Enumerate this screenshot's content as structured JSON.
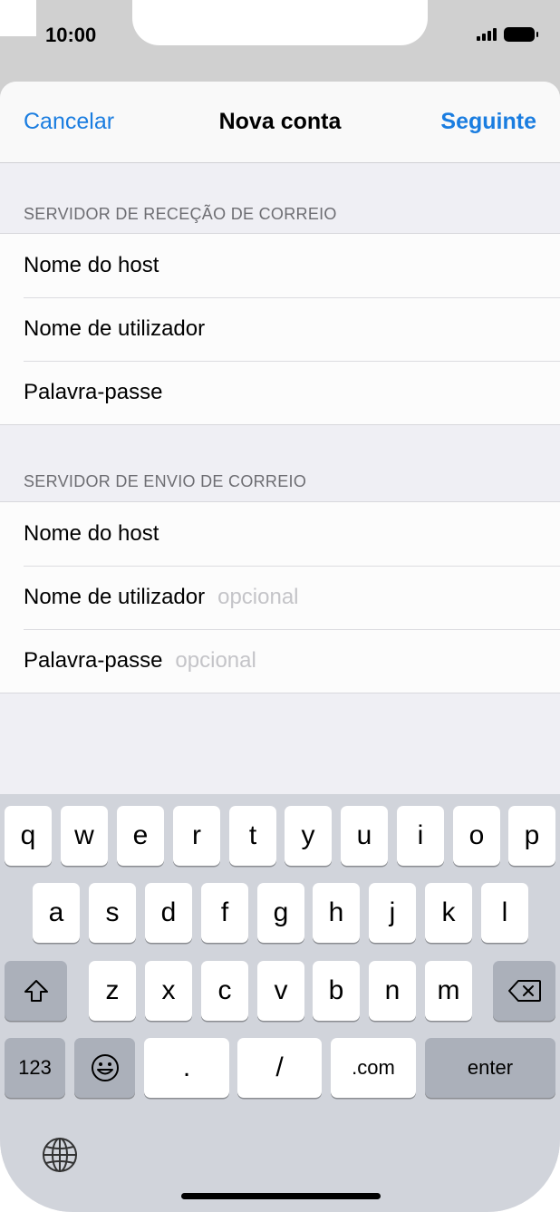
{
  "status": {
    "time": "10:00"
  },
  "navbar": {
    "cancel": "Cancelar",
    "title": "Nova conta",
    "next": "Seguinte"
  },
  "incoming": {
    "header": "SERVIDOR DE RECEÇÃO DE CORREIO",
    "rows": [
      {
        "label": "Nome do host",
        "placeholder": ""
      },
      {
        "label": "Nome de utilizador",
        "placeholder": ""
      },
      {
        "label": "Palavra-passe",
        "placeholder": ""
      }
    ]
  },
  "outgoing": {
    "header": "SERVIDOR DE ENVIO DE CORREIO",
    "rows": [
      {
        "label": "Nome do host",
        "placeholder": ""
      },
      {
        "label": "Nome de utilizador",
        "placeholder": "opcional"
      },
      {
        "label": "Palavra-passe",
        "placeholder": "opcional"
      }
    ]
  },
  "keyboard": {
    "row1": [
      "q",
      "w",
      "e",
      "r",
      "t",
      "y",
      "u",
      "i",
      "o",
      "p"
    ],
    "row2": [
      "a",
      "s",
      "d",
      "f",
      "g",
      "h",
      "j",
      "k",
      "l"
    ],
    "row3": [
      "z",
      "x",
      "c",
      "v",
      "b",
      "n",
      "m"
    ],
    "numbers": "123",
    "dot": ".",
    "slash": "/",
    "dotcom": ".com",
    "enter": "enter",
    "icons": {
      "shift": "shift-icon",
      "backspace": "backspace-icon",
      "emoji": "emoji-icon",
      "globe": "globe-icon"
    }
  },
  "colors": {
    "accent": "#1a7de0",
    "placeholder": "#c4c4c8",
    "group_bg": "#efeff4",
    "keyboard_bg": "#d1d4db"
  }
}
